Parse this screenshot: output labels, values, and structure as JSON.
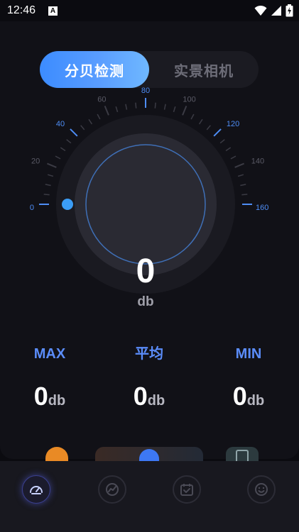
{
  "status_bar": {
    "time": "12:46",
    "notification_badge": "A"
  },
  "segmented_control": {
    "active_label": "分贝检测",
    "inactive_label": "实景相机"
  },
  "gauge": {
    "reading": "0",
    "unit": "db",
    "ticks": [
      {
        "label": "0",
        "value": 0
      },
      {
        "label": "20",
        "value": 20
      },
      {
        "label": "40",
        "value": 40
      },
      {
        "label": "60",
        "value": 60
      },
      {
        "label": "80",
        "value": 80
      },
      {
        "label": "100",
        "value": 100
      },
      {
        "label": "120",
        "value": 120
      },
      {
        "label": "140",
        "value": 140
      },
      {
        "label": "160",
        "value": 160
      }
    ],
    "range": [
      0,
      160
    ],
    "accent_color": "#4e8df5",
    "knob_color": "#3b9cf5"
  },
  "stats": {
    "max": {
      "label": "MAX",
      "value": "0",
      "unit": "db"
    },
    "avg": {
      "label": "平均",
      "value": "0",
      "unit": "db"
    },
    "min": {
      "label": "MIN",
      "value": "0",
      "unit": "db"
    }
  },
  "tabbar": {
    "items": [
      {
        "icon": "speedometer-icon",
        "active": true
      },
      {
        "icon": "trend-chart-icon",
        "active": false
      },
      {
        "icon": "calendar-check-icon",
        "active": false
      },
      {
        "icon": "smiley-icon",
        "active": false
      }
    ]
  },
  "colors": {
    "accent": "#5b8dfb",
    "background": "#0b0b10"
  }
}
